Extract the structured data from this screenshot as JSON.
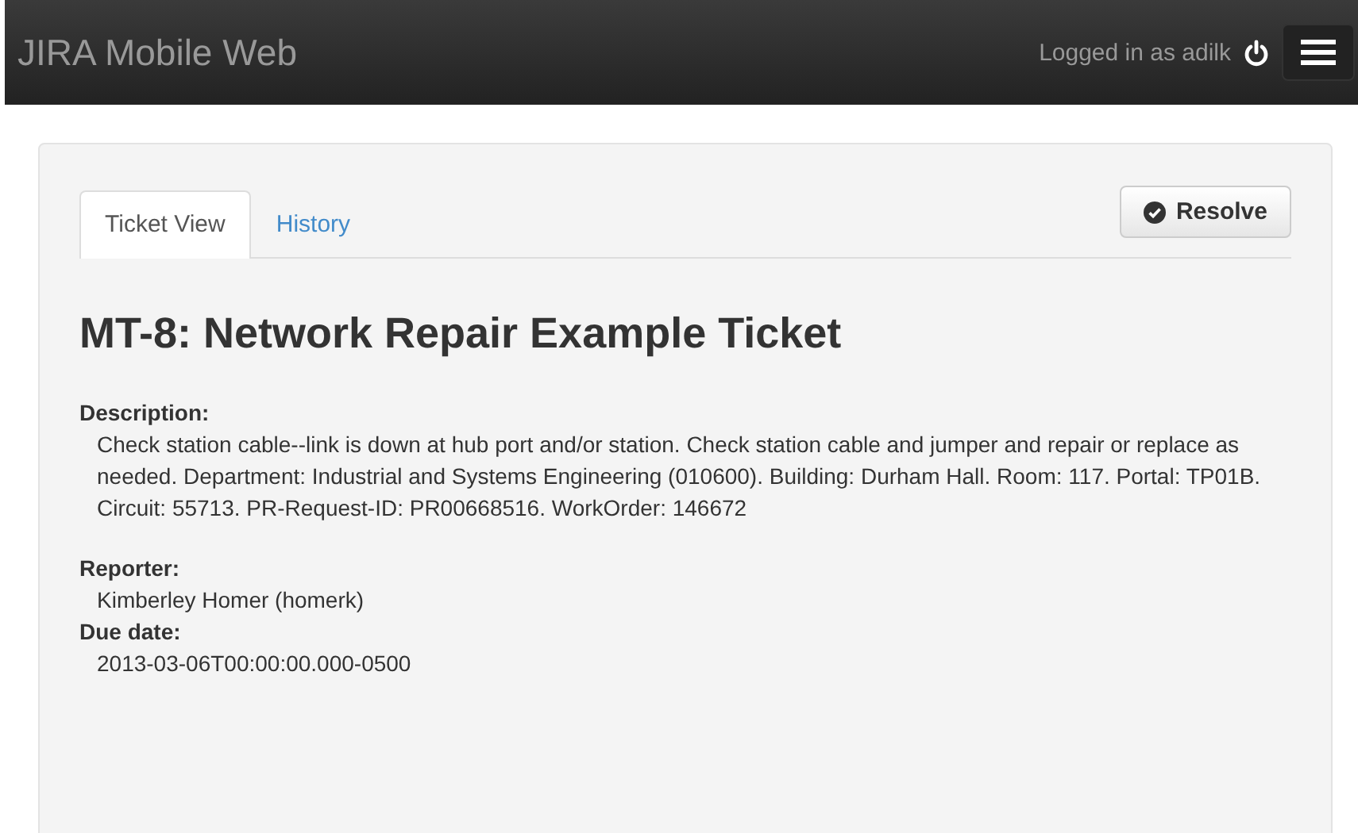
{
  "navbar": {
    "brand": "JIRA Mobile Web",
    "user": "Logged in as adilk"
  },
  "tabs": [
    {
      "label": "Ticket View",
      "selected": true
    },
    {
      "label": "History",
      "selected": false
    }
  ],
  "resolve_button": "Resolve",
  "ticket": {
    "title": "MT-8: Network Repair Example Ticket",
    "fields": [
      {
        "kind": "paragraph",
        "label": "Description:",
        "value": "Check station cable--link is down at hub port and/or station. Check station cable and jumper and repair or replace as needed. Department: Industrial and Systems Engineering (010600). Building: Durham Hall. Room: 117. Portal: TP01B. Circuit: 55713. PR-Request-ID: PR00668516. WorkOrder: 146672"
      },
      {
        "kind": "line",
        "label": "Reporter:",
        "value": "Kimberley Homer (homerk)"
      },
      {
        "kind": "line",
        "label": "Due date:",
        "value": "2013-03-06T00:00:00.000-0500"
      }
    ]
  }
}
